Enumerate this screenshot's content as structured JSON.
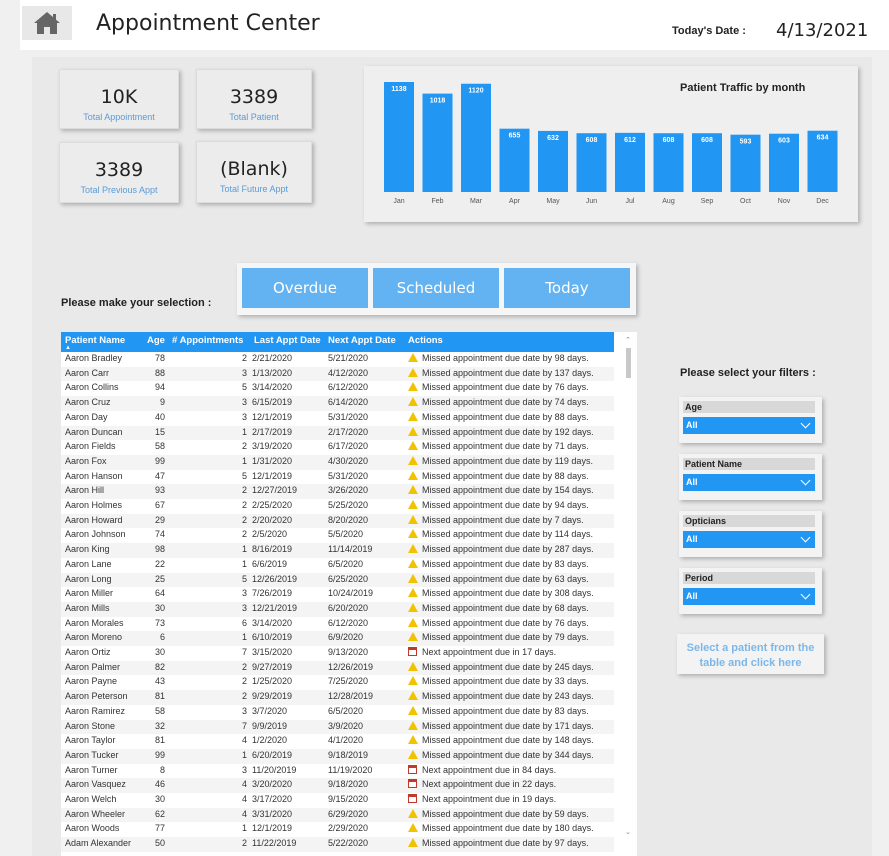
{
  "header": {
    "title": "Appointment Center",
    "date_label": "Today's Date :",
    "date_value": "4/13/2021"
  },
  "kpis": [
    {
      "value": "10K",
      "label": "Total Appointment"
    },
    {
      "value": "3389",
      "label": "Total Patient"
    },
    {
      "value": "3389",
      "label": "Total Previous Appt"
    },
    {
      "value": "(Blank)",
      "label": "Total Future Appt"
    }
  ],
  "chart_data": {
    "type": "bar",
    "title": "Patient Traffic by month",
    "categories": [
      "Jan",
      "Feb",
      "Mar",
      "Apr",
      "May",
      "Jun",
      "Jul",
      "Aug",
      "Sep",
      "Oct",
      "Nov",
      "Dec"
    ],
    "values": [
      1138,
      1018,
      1120,
      655,
      632,
      608,
      612,
      608,
      608,
      593,
      603,
      634
    ],
    "ylim": [
      0,
      1138
    ],
    "bar_color": "#2196f3",
    "grid": false
  },
  "selection": {
    "prompt": "Please make your selection :",
    "buttons": [
      "Overdue",
      "Scheduled",
      "Today"
    ]
  },
  "table": {
    "columns": [
      "Patient Name",
      "Age",
      "# Appointments",
      "Last Appt Date",
      "Next Appt Date",
      "Actions"
    ],
    "rows": [
      [
        "Aaron Bradley",
        "78",
        "2",
        "2/21/2020",
        "5/21/2020",
        "warn",
        "Missed appointment due date by 98 days."
      ],
      [
        "Aaron Carr",
        "88",
        "3",
        "1/13/2020",
        "4/12/2020",
        "warn",
        "Missed appointment due date by 137 days."
      ],
      [
        "Aaron Collins",
        "94",
        "5",
        "3/14/2020",
        "6/12/2020",
        "warn",
        "Missed appointment due date by 76 days."
      ],
      [
        "Aaron Cruz",
        "9",
        "3",
        "6/15/2019",
        "6/14/2020",
        "warn",
        "Missed appointment due date by 74 days."
      ],
      [
        "Aaron Day",
        "40",
        "3",
        "12/1/2019",
        "5/31/2020",
        "warn",
        "Missed appointment due date by 88 days."
      ],
      [
        "Aaron Duncan",
        "15",
        "1",
        "2/17/2019",
        "2/17/2020",
        "warn",
        "Missed appointment due date by 192 days."
      ],
      [
        "Aaron Fields",
        "58",
        "2",
        "3/19/2020",
        "6/17/2020",
        "warn",
        "Missed appointment due date by 71 days."
      ],
      [
        "Aaron Fox",
        "99",
        "1",
        "1/31/2020",
        "4/30/2020",
        "warn",
        "Missed appointment due date by 119 days."
      ],
      [
        "Aaron Hanson",
        "47",
        "5",
        "12/1/2019",
        "5/31/2020",
        "warn",
        "Missed appointment due date by 88 days."
      ],
      [
        "Aaron Hill",
        "93",
        "2",
        "12/27/2019",
        "3/26/2020",
        "warn",
        "Missed appointment due date by 154 days."
      ],
      [
        "Aaron Holmes",
        "67",
        "2",
        "2/25/2020",
        "5/25/2020",
        "warn",
        "Missed appointment due date by 94 days."
      ],
      [
        "Aaron Howard",
        "29",
        "2",
        "2/20/2020",
        "8/20/2020",
        "warn",
        "Missed appointment due date by 7 days."
      ],
      [
        "Aaron Johnson",
        "74",
        "2",
        "2/5/2020",
        "5/5/2020",
        "warn",
        "Missed appointment due date by 114 days."
      ],
      [
        "Aaron King",
        "98",
        "1",
        "8/16/2019",
        "11/14/2019",
        "warn",
        "Missed appointment due date by 287 days."
      ],
      [
        "Aaron Lane",
        "22",
        "1",
        "6/6/2019",
        "6/5/2020",
        "warn",
        "Missed appointment due date by 83 days."
      ],
      [
        "Aaron Long",
        "25",
        "5",
        "12/26/2019",
        "6/25/2020",
        "warn",
        "Missed appointment due date by 63 days."
      ],
      [
        "Aaron Miller",
        "64",
        "3",
        "7/26/2019",
        "10/24/2019",
        "warn",
        "Missed appointment due date by 308 days."
      ],
      [
        "Aaron Mills",
        "30",
        "3",
        "12/21/2019",
        "6/20/2020",
        "warn",
        "Missed appointment due date by 68 days."
      ],
      [
        "Aaron Morales",
        "73",
        "6",
        "3/14/2020",
        "6/12/2020",
        "warn",
        "Missed appointment due date by 76 days."
      ],
      [
        "Aaron Moreno",
        "6",
        "1",
        "6/10/2019",
        "6/9/2020",
        "warn",
        "Missed appointment due date by 79 days."
      ],
      [
        "Aaron Ortiz",
        "30",
        "7",
        "3/15/2020",
        "9/13/2020",
        "cal",
        "Next appointment due in 17 days."
      ],
      [
        "Aaron Palmer",
        "82",
        "2",
        "9/27/2019",
        "12/26/2019",
        "warn",
        "Missed appointment due date by 245 days."
      ],
      [
        "Aaron Payne",
        "43",
        "2",
        "1/25/2020",
        "7/25/2020",
        "warn",
        "Missed appointment due date by 33 days."
      ],
      [
        "Aaron Peterson",
        "81",
        "2",
        "9/29/2019",
        "12/28/2019",
        "warn",
        "Missed appointment due date by 243 days."
      ],
      [
        "Aaron Ramirez",
        "58",
        "3",
        "3/7/2020",
        "6/5/2020",
        "warn",
        "Missed appointment due date by 83 days."
      ],
      [
        "Aaron Stone",
        "32",
        "7",
        "9/9/2019",
        "3/9/2020",
        "warn",
        "Missed appointment due date by 171 days."
      ],
      [
        "Aaron Taylor",
        "81",
        "4",
        "1/2/2020",
        "4/1/2020",
        "warn",
        "Missed appointment due date by 148 days."
      ],
      [
        "Aaron Tucker",
        "99",
        "1",
        "6/20/2019",
        "9/18/2019",
        "warn",
        "Missed appointment due date by 344 days."
      ],
      [
        "Aaron Turner",
        "8",
        "3",
        "11/20/2019",
        "11/19/2020",
        "cal",
        "Next appointment due in 84 days."
      ],
      [
        "Aaron Vasquez",
        "46",
        "4",
        "3/20/2020",
        "9/18/2020",
        "cal",
        "Next appointment due in 22 days."
      ],
      [
        "Aaron Welch",
        "30",
        "4",
        "3/17/2020",
        "9/15/2020",
        "cal",
        "Next appointment due in 19 days."
      ],
      [
        "Aaron Wheeler",
        "62",
        "4",
        "3/31/2020",
        "6/29/2020",
        "warn",
        "Missed appointment due date by 59 days."
      ],
      [
        "Aaron Woods",
        "77",
        "1",
        "12/1/2019",
        "2/29/2020",
        "warn",
        "Missed appointment due date by 180 days."
      ],
      [
        "Adam Alexander",
        "50",
        "2",
        "11/22/2019",
        "5/22/2020",
        "warn",
        "Missed appointment due date by 97 days."
      ]
    ]
  },
  "filters": {
    "prompt": "Please select your filters :",
    "items": [
      {
        "label": "Age",
        "value": "All"
      },
      {
        "label": "Patient Name",
        "value": "All"
      },
      {
        "label": "Opticians",
        "value": "All"
      },
      {
        "label": "Period",
        "value": "All"
      }
    ]
  },
  "patient_action": {
    "line1": "Select a patient from the",
    "line2": "table and click here"
  },
  "icons": {
    "home": "home-icon",
    "warning": "warning-icon",
    "calendar": "calendar-icon",
    "chevron": "chevron-down-icon"
  },
  "colors": {
    "accent": "#2196f3",
    "button": "#63b3f2",
    "kpi_label": "#5b9bd5",
    "warning": "#f2c200",
    "calendar": "#c0392b"
  }
}
